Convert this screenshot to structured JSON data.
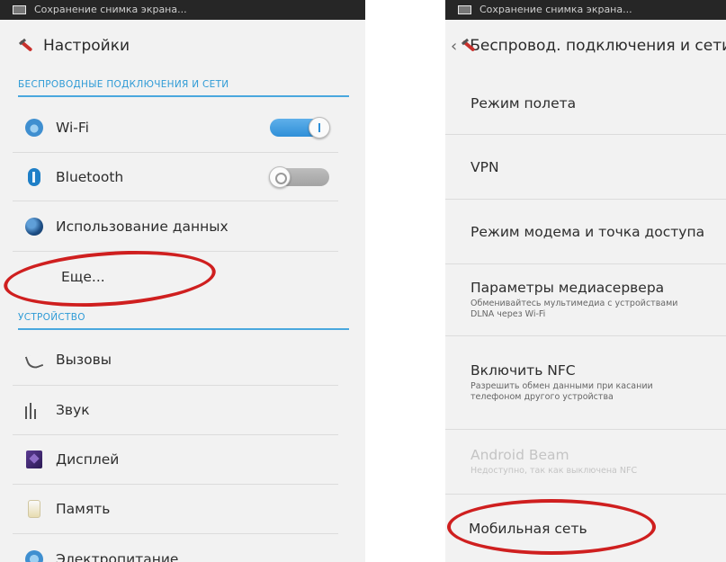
{
  "statusbar": {
    "text": "Сохранение снимка экрана..."
  },
  "left": {
    "title": "Настройки",
    "section_wireless": "БЕСПРОВОДНЫЕ ПОДКЛЮЧЕНИЯ И СЕТИ",
    "section_device": "УСТРОЙСТВО",
    "items": {
      "wifi": "Wi-Fi",
      "bluetooth": "Bluetooth",
      "data_usage": "Использование данных",
      "more": "Еще...",
      "calls": "Вызовы",
      "sound": "Звук",
      "display": "Дисплей",
      "memory": "Память",
      "power": "Электропитание"
    },
    "toggles": {
      "wifi": "on",
      "bluetooth": "off"
    }
  },
  "right": {
    "title": "Беспровод. подключения и сети",
    "items": {
      "airplane": "Режим полета",
      "vpn": "VPN",
      "tethering": "Режим модема и точка доступа",
      "media_server": "Параметры медиасервера",
      "media_server_sub": "Обменивайтесь мультимедиа с устройствами DLNA через Wi-Fi",
      "nfc": "Включить NFC",
      "nfc_sub": "Разрешить обмен данными при касании телефоном другого устройства",
      "android_beam": "Android Beam",
      "android_beam_sub": "Недоступно, так как выключена NFC",
      "mobile_network": "Мобильная сеть"
    }
  },
  "colors": {
    "accent": "#2f9bd6",
    "highlight": "#cf1f1f",
    "toggle_on": "#2f8fd8",
    "toggle_off": "#a3a3a3"
  }
}
